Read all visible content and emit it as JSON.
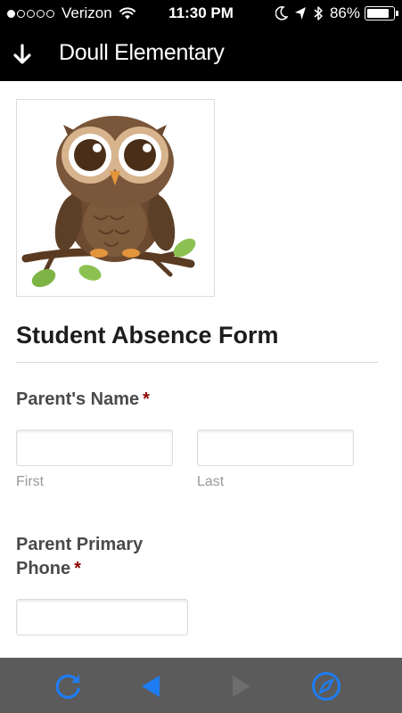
{
  "status_bar": {
    "carrier": "Verizon",
    "time": "11:30 PM",
    "battery_percent": "86%",
    "battery_level": 0.86,
    "signal_bars_filled": 1,
    "signal_bars_total": 5
  },
  "header": {
    "title": "Doull Elementary",
    "back_icon": "down-arrow-icon"
  },
  "form": {
    "title": "Student Absence Form",
    "image": "owl-illustration",
    "fields": {
      "parent_name": {
        "label": "Parent's Name",
        "required_mark": "*",
        "first": {
          "value": "",
          "placeholder": "",
          "sublabel": "First"
        },
        "last": {
          "value": "",
          "placeholder": "",
          "sublabel": "Last"
        }
      },
      "parent_phone": {
        "label": "Parent Primary Phone",
        "required_mark": "*",
        "value": "",
        "placeholder": ""
      }
    }
  },
  "toolbar": {
    "icons": [
      "refresh-icon",
      "back-icon",
      "forward-icon",
      "compass-icon"
    ],
    "active_color": "#1e7cf2",
    "disabled_color": "#6e6e6e"
  },
  "colors": {
    "header_bg": "#000000",
    "toolbar_bg": "#5b5b5b",
    "required": "#8b0000"
  }
}
